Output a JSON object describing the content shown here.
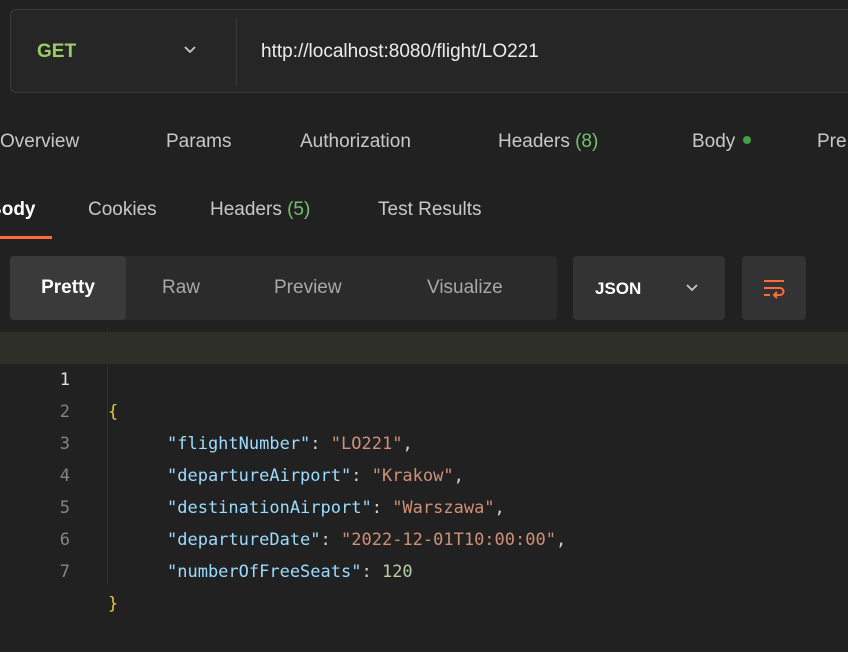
{
  "request": {
    "method": "GET",
    "url": "http://localhost:8080/flight/LO221"
  },
  "tabs": {
    "overview": "Overview",
    "params": "Params",
    "authorization": "Authorization",
    "headers_label": "Headers",
    "headers_count": "(8)",
    "body": "Body",
    "pre": "Pre"
  },
  "response_tabs": {
    "body": "Body",
    "cookies": "Cookies",
    "headers_label": "Headers",
    "headers_count": "(5)",
    "test_results": "Test Results"
  },
  "view_modes": {
    "pretty": "Pretty",
    "raw": "Raw",
    "preview": "Preview",
    "visualize": "Visualize"
  },
  "format": {
    "selected": "JSON"
  },
  "code": {
    "open_brace": "{",
    "close_brace": "}",
    "line_numbers": [
      "1",
      "2",
      "3",
      "4",
      "5",
      "6",
      "7"
    ],
    "rows": [
      {
        "key": "\"flightNumber\"",
        "value": "\"LO221\"",
        "type": "string",
        "comma": ","
      },
      {
        "key": "\"departureAirport\"",
        "value": "\"Krakow\"",
        "type": "string",
        "comma": ","
      },
      {
        "key": "\"destinationAirport\"",
        "value": "\"Warszawa\"",
        "type": "string",
        "comma": ","
      },
      {
        "key": "\"departureDate\"",
        "value": "\"2022-12-01T10:00:00\"",
        "type": "string",
        "comma": ","
      },
      {
        "key": "\"numberOfFreeSeats\"",
        "value": "120",
        "type": "number",
        "comma": ""
      }
    ]
  },
  "colors": {
    "method_green": "#9ccc65",
    "accent_orange": "#ff6c37",
    "key_blue": "#9cdcfe",
    "string_orange": "#ce9178",
    "number_green": "#b5cea8"
  },
  "icons": {
    "method_dropdown": "chevron-down-icon",
    "format_dropdown": "chevron-down-icon",
    "wrap": "wrap-lines-icon",
    "body_status": "green-dot-icon"
  }
}
